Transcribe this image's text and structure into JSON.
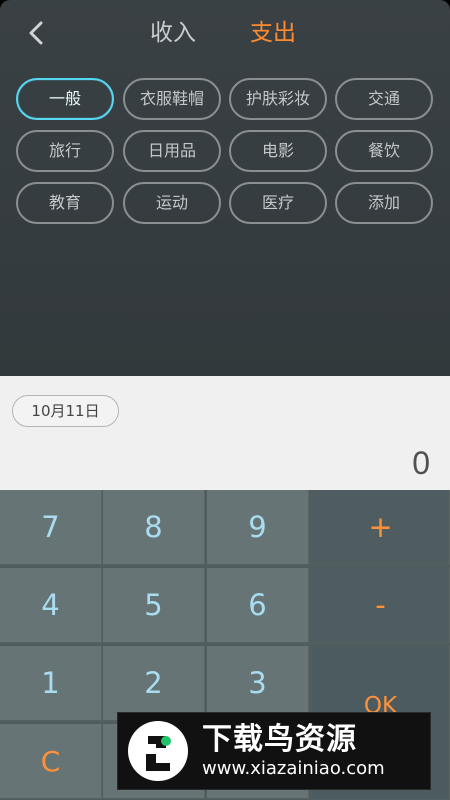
{
  "header": {
    "back_icon": "chevron-left-icon",
    "tabs": [
      {
        "label": "收入"
      },
      {
        "label": "支出"
      }
    ]
  },
  "categories": [
    {
      "label": "一般"
    },
    {
      "label": "衣服鞋帽"
    },
    {
      "label": "护肤彩妆"
    },
    {
      "label": "交通"
    },
    {
      "label": "旅行"
    },
    {
      "label": "日用品"
    },
    {
      "label": "电影"
    },
    {
      "label": "餐饮"
    },
    {
      "label": "教育"
    },
    {
      "label": "运动"
    },
    {
      "label": "医疗"
    },
    {
      "label": "添加"
    }
  ],
  "entry": {
    "date": "10月11日",
    "amount": "0"
  },
  "keypad": {
    "digits": [
      "7",
      "8",
      "9",
      "4",
      "5",
      "6",
      "1",
      "2",
      "3"
    ],
    "plus": "+",
    "minus": "-",
    "clear": "C",
    "ok": "OK"
  },
  "watermark": {
    "title": "下载鸟资源",
    "url": "www.xiazainiao.com"
  }
}
